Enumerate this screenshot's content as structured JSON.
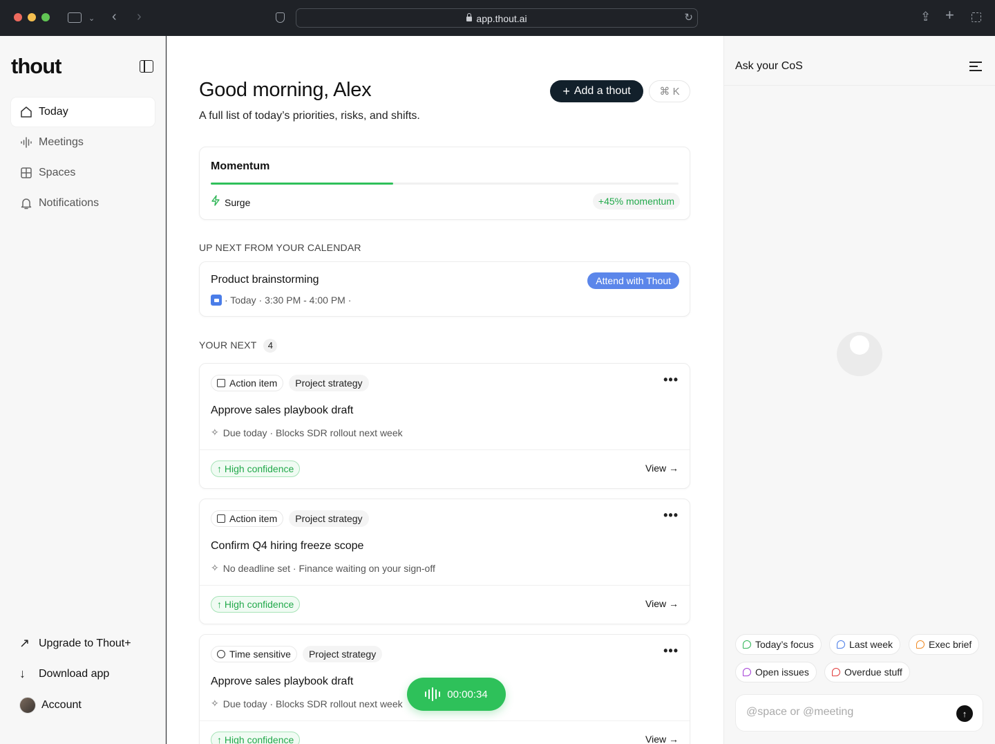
{
  "browser": {
    "url": "app.thout.ai"
  },
  "sidebar": {
    "logo": "thout",
    "nav": [
      {
        "label": "Today"
      },
      {
        "label": "Meetings"
      },
      {
        "label": "Spaces"
      },
      {
        "label": "Notifications"
      }
    ],
    "bottom": {
      "upgrade": "Upgrade to Thout+",
      "download": "Download app",
      "account": "Account"
    }
  },
  "main": {
    "greeting": "Good morning, Alex",
    "subtitle": "A full list of today’s priorities, risks, and shifts.",
    "add_button": "Add a thout",
    "shortcut": "⌘ K",
    "momentum": {
      "title": "Momentum",
      "progress": 0.39,
      "status": "Surge",
      "badge": "+45% momentum"
    },
    "calendar_label": "UP NEXT FROM YOUR CALENDAR",
    "meeting": {
      "title": "Product brainstorming",
      "meta": "· Today · 3:30 PM - 4:00 PM ·",
      "action": "Attend with Thout"
    },
    "next_label": "YOUR NEXT",
    "next_count": "4",
    "tasks": [
      {
        "type": "Action item",
        "project": "Project strategy",
        "title": "Approve sales playbook draft",
        "meta": "Due today · Blocks SDR rollout next week",
        "confidence": "High confidence",
        "view": "View →"
      },
      {
        "type": "Action item",
        "project": "Project strategy",
        "title": "Confirm Q4 hiring freeze scope",
        "meta": "No deadline set · Finance waiting on your sign-off",
        "confidence": "High confidence",
        "view": "View →"
      },
      {
        "type": "Time sensitive",
        "project": "Project strategy",
        "title": "Approve sales playbook draft",
        "meta": "Due today · Blocks SDR rollout next week",
        "confidence": "High confidence",
        "view": "View →"
      }
    ],
    "recorder_time": "00:00:34"
  },
  "right_panel": {
    "title": "Ask your CoS",
    "chips": [
      {
        "label": "Today’s focus",
        "color": "#2fb556"
      },
      {
        "label": "Last week",
        "color": "#4a7de8"
      },
      {
        "label": "Exec brief",
        "color": "#f08a24"
      },
      {
        "label": "Open issues",
        "color": "#a43ed6"
      },
      {
        "label": "Overdue stuff",
        "color": "#e03a3a"
      }
    ],
    "input_placeholder": "@space or @meeting"
  },
  "colors": {
    "accent_green": "#2ec15a",
    "primary_dark": "#12202b",
    "attend_blue": "#5b86ea"
  }
}
